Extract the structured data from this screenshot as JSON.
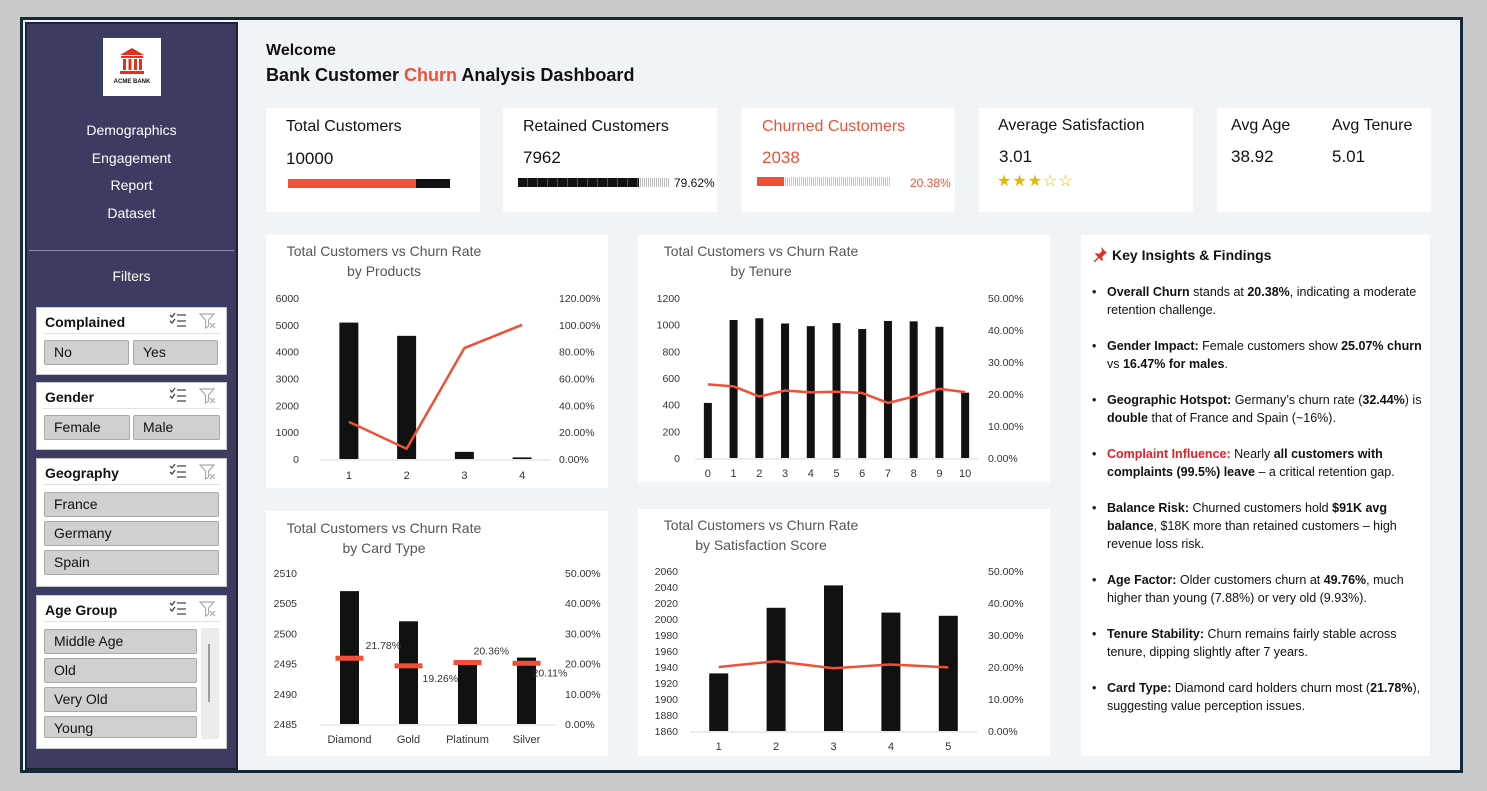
{
  "sidebar": {
    "logo_text": "ACME BANK",
    "nav": [
      "Demographics",
      "Engagement",
      "Report",
      "Dataset"
    ],
    "filters_label": "Filters",
    "slicers": [
      {
        "title": "Complained",
        "items": [
          "No",
          "Yes"
        ]
      },
      {
        "title": "Gender",
        "items": [
          "Female",
          "Male"
        ]
      },
      {
        "title": "Geography",
        "items": [
          "France",
          "Germany",
          "Spain"
        ]
      },
      {
        "title": "Age Group",
        "items": [
          "Middle Age",
          "Old",
          "Very Old",
          "Young"
        ]
      }
    ]
  },
  "header": {
    "welcome": "Welcome",
    "title_pre": "Bank Customer ",
    "title_accent": "Churn",
    "title_post": " Analysis Dashboard"
  },
  "kpis": {
    "total": {
      "label": "Total Customers",
      "value": "10000",
      "bar_fill": 0.79
    },
    "retained": {
      "label": "Retained Customers",
      "value": "7962",
      "pct": "79.62%",
      "bar_fill": 0.7962
    },
    "churned": {
      "label": "Churned Customers",
      "value": "2038",
      "pct": "20.38%",
      "bar_fill": 0.2038
    },
    "satisfaction": {
      "label": "Average Satisfaction",
      "value": "3.01",
      "stars": "★★★☆☆",
      "rating": 3
    },
    "age": {
      "label": "Avg Age",
      "value": "38.92"
    },
    "tenure": {
      "label": "Avg Tenure",
      "value": "5.01"
    }
  },
  "colors": {
    "accent": "#ef5037",
    "bar": "#111111",
    "sidebar": "#3c3b62",
    "star": "#e6b800"
  },
  "chart_data": [
    {
      "type": "bar",
      "title": "Total Customers vs Churn Rate",
      "subtitle": "by Products",
      "categories": [
        "1",
        "2",
        "3",
        "4"
      ],
      "series": [
        {
          "values": [
            5084,
            4590,
            266,
            60
          ]
        },
        {
          "values": [
            27.7,
            7.6,
            82.7,
            100.0
          ]
        }
      ],
      "ylim": [
        0,
        6000
      ],
      "y2lim": [
        0,
        120
      ],
      "yticks": [
        "6000",
        "5000",
        "4000",
        "3000",
        "2000",
        "1000",
        "0"
      ],
      "y2ticks": [
        "120.00%",
        "100.00%",
        "80.00%",
        "60.00%",
        "40.00%",
        "20.00%",
        "0.00%"
      ]
    },
    {
      "type": "bar",
      "title": "Total Customers vs Churn Rate",
      "subtitle": "by Tenure",
      "categories": [
        "0",
        "1",
        "2",
        "3",
        "4",
        "5",
        "6",
        "7",
        "8",
        "9",
        "10"
      ],
      "series": [
        {
          "values": [
            413,
            1035,
            1048,
            1009,
            989,
            1012,
            967,
            1028,
            1025,
            984,
            490
          ]
        },
        {
          "values": [
            23.0,
            22.4,
            19.2,
            21.1,
            20.5,
            20.7,
            20.3,
            17.2,
            19.2,
            21.6,
            20.6
          ]
        }
      ],
      "ylim": [
        0,
        1200
      ],
      "y2lim": [
        0,
        50
      ],
      "yticks": [
        "1200",
        "1000",
        "800",
        "600",
        "400",
        "200",
        "0"
      ],
      "y2ticks": [
        "50.00%",
        "40.00%",
        "30.00%",
        "20.00%",
        "10.00%",
        "0.00%"
      ]
    },
    {
      "type": "bar",
      "title": "Total Customers vs Churn Rate",
      "subtitle": "by Card Type",
      "categories": [
        "Diamond",
        "Gold",
        "Platinum",
        "Silver"
      ],
      "series": [
        {
          "values": [
            2507,
            2502,
            2495,
            2496
          ]
        },
        {
          "values": [
            21.78,
            19.26,
            20.36,
            20.11
          ]
        }
      ],
      "data_labels": [
        "21.78%",
        "19.26%",
        "20.36%",
        "20.11%"
      ],
      "ylim": [
        2485,
        2510
      ],
      "y2lim": [
        0,
        50
      ],
      "yticks": [
        "2510",
        "2505",
        "2500",
        "2495",
        "2490",
        "2485"
      ],
      "y2ticks": [
        "50.00%",
        "40.00%",
        "30.00%",
        "20.00%",
        "10.00%",
        "0.00%"
      ]
    },
    {
      "type": "bar",
      "title": "Total Customers vs Churn Rate",
      "subtitle": "by Satisfaction Score",
      "categories": [
        "1",
        "2",
        "3",
        "4",
        "5"
      ],
      "series": [
        {
          "values": [
            1932,
            2014,
            2042,
            2008,
            2004
          ]
        },
        {
          "values": [
            20.0,
            21.8,
            19.6,
            20.8,
            19.9
          ]
        }
      ],
      "ylim": [
        1860,
        2060
      ],
      "y2lim": [
        0,
        50
      ],
      "yticks": [
        "2060",
        "2040",
        "2020",
        "2000",
        "1980",
        "1960",
        "1940",
        "1920",
        "1900",
        "1880",
        "1860"
      ],
      "y2ticks": [
        "50.00%",
        "40.00%",
        "30.00%",
        "20.00%",
        "10.00%",
        "0.00%"
      ]
    }
  ],
  "insights": {
    "title": "Key Insights & Findings",
    "items": [
      {
        "head": "Overall Churn",
        "parts": [
          [
            "",
            " stands at "
          ],
          [
            "b",
            "20.38%"
          ],
          [
            "",
            ", indicating a moderate retention challenge."
          ]
        ]
      },
      {
        "head": "Gender Impact:",
        "parts": [
          [
            "",
            " Female customers show "
          ],
          [
            "b",
            "25.07% churn"
          ],
          [
            "",
            " vs "
          ],
          [
            "b",
            "16.47% for males"
          ],
          [
            "",
            "."
          ]
        ]
      },
      {
        "head": "Geographic Hotspot:",
        "parts": [
          [
            "",
            " Germany’s churn rate ("
          ],
          [
            "b",
            "32.44%"
          ],
          [
            "",
            ") is "
          ],
          [
            "b",
            "double"
          ],
          [
            "",
            " that of France and Spain (~16%)."
          ]
        ]
      },
      {
        "head": "Complaint Influence:",
        "red": true,
        "parts": [
          [
            "",
            " Nearly "
          ],
          [
            "b",
            "all customers with complaints (99.5%) leave"
          ],
          [
            "",
            " – a critical retention gap."
          ]
        ]
      },
      {
        "head": "Balance Risk:",
        "parts": [
          [
            "",
            " Churned customers hold "
          ],
          [
            "b",
            "$91K avg balance"
          ],
          [
            "",
            ", $18K more than retained customers – high revenue loss risk."
          ]
        ]
      },
      {
        "head": "Age Factor:",
        "parts": [
          [
            "",
            " Older customers churn at "
          ],
          [
            "b",
            "49.76%"
          ],
          [
            "",
            ", much higher than young (7.88%) or very old (9.93%)."
          ]
        ]
      },
      {
        "head": "Tenure Stability:",
        "parts": [
          [
            "",
            " Churn remains fairly stable across tenure, dipping slightly after 7 years."
          ]
        ]
      },
      {
        "head": "Card Type:",
        "parts": [
          [
            "",
            " Diamond card holders churn most ("
          ],
          [
            "b",
            "21.78%"
          ],
          [
            "",
            "), suggesting value perception issues."
          ]
        ]
      }
    ]
  }
}
